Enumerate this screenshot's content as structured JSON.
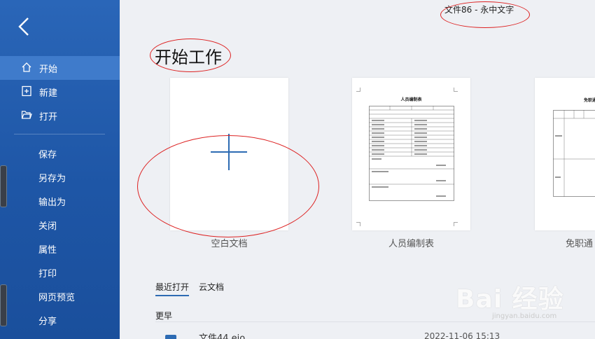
{
  "window": {
    "title": "文件86 - 永中文字"
  },
  "sidebar": {
    "back_icon": "chevron-left-icon",
    "items": [
      {
        "label": "开始",
        "icon": "home-icon",
        "active": true
      },
      {
        "label": "新建",
        "icon": "new-doc-icon"
      },
      {
        "label": "打开",
        "icon": "folder-open-icon"
      },
      {
        "label": "保存"
      },
      {
        "label": "另存为"
      },
      {
        "label": "输出为"
      },
      {
        "label": "关闭"
      },
      {
        "label": "属性"
      },
      {
        "label": "打印"
      },
      {
        "label": "网页预览"
      },
      {
        "label": "分享"
      }
    ]
  },
  "main": {
    "heading": "开始工作",
    "templates": [
      {
        "label": "空白文档",
        "kind": "blank"
      },
      {
        "label": "人员编制表",
        "kind": "table"
      },
      {
        "label": "免职通",
        "kind": "form"
      }
    ],
    "table_preview_title": "人员编制表",
    "form_preview_title": "免职通",
    "tabs": [
      {
        "label": "最近打开",
        "active": true
      },
      {
        "label": "云文档",
        "active": false
      }
    ],
    "section_label": "更早",
    "recent_files": [
      {
        "name": "文件44.eio",
        "date": "2022-11-06 15:13"
      }
    ]
  },
  "watermark": {
    "brand": "Bai  经验",
    "url": "jingyan.baidu.com"
  },
  "colors": {
    "sidebar": "#1e56a6",
    "sidebar_active": "#3f7bcb",
    "accent": "#2d6bb3",
    "annotation": "#dd2222"
  }
}
